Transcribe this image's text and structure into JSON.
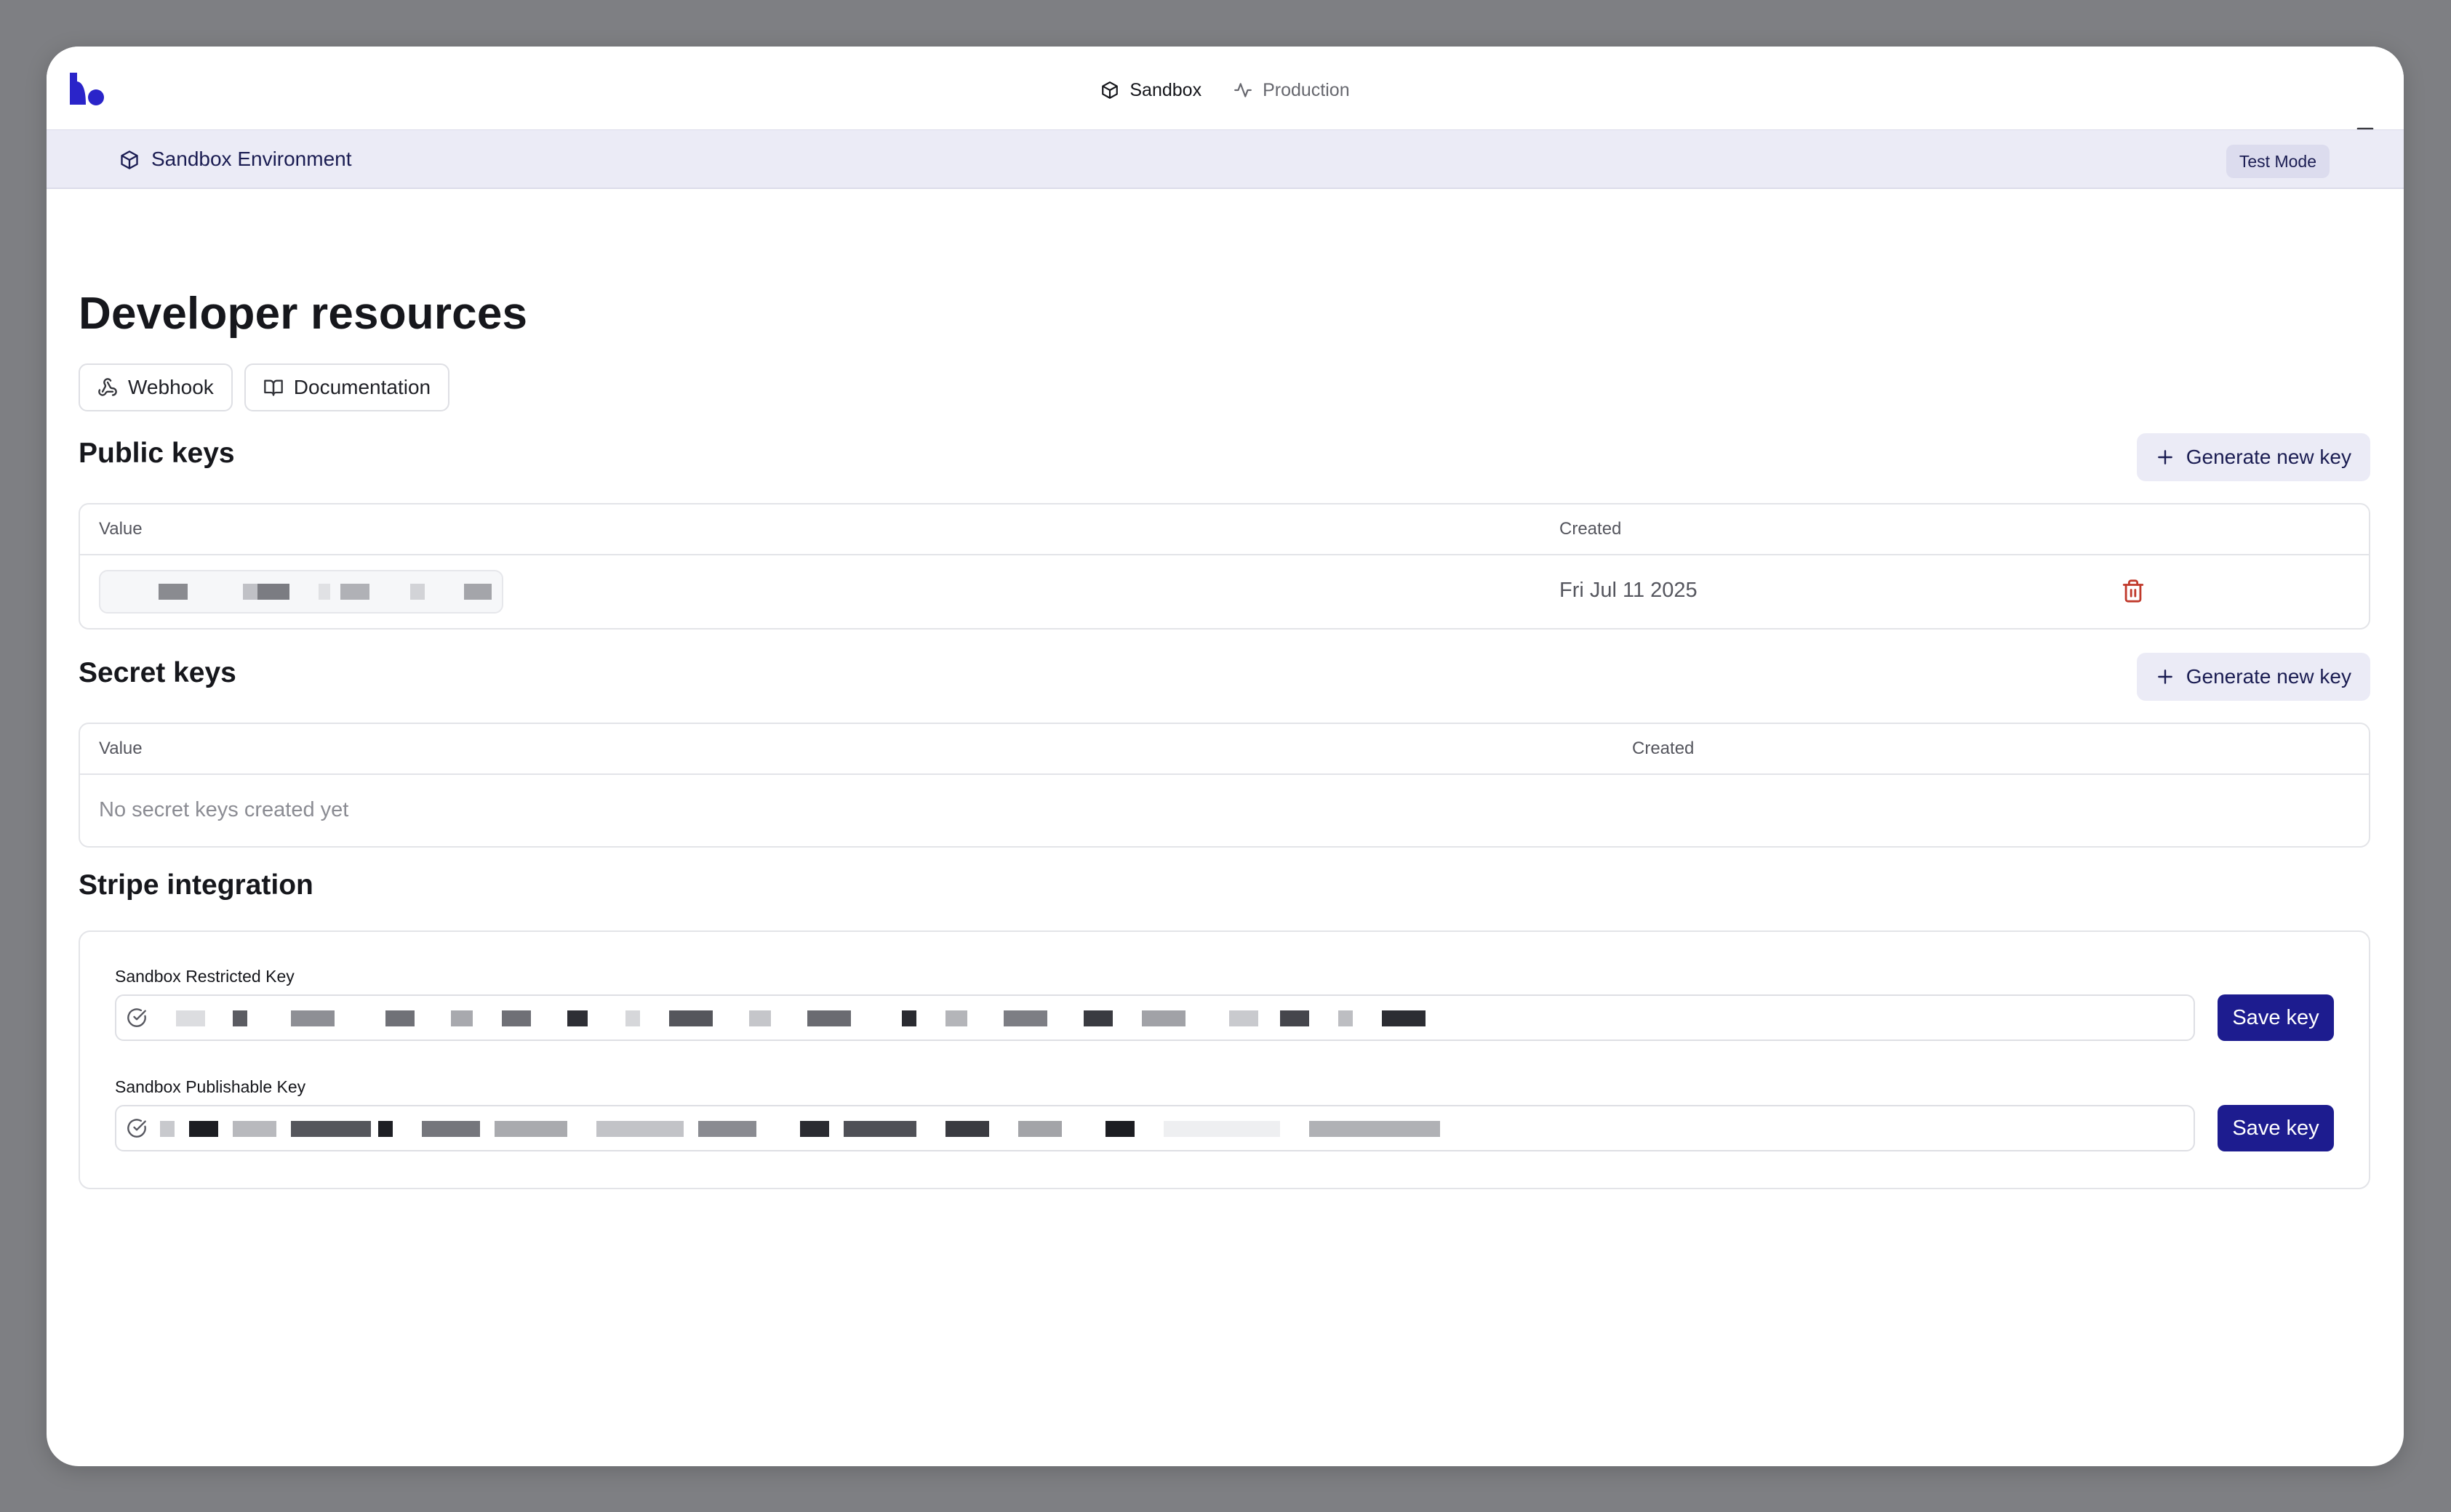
{
  "header": {
    "env_tabs": [
      {
        "label": "Sandbox",
        "icon": "box-icon",
        "active": true
      },
      {
        "label": "Production",
        "icon": "activity-icon",
        "active": false
      }
    ]
  },
  "banner": {
    "title": "Sandbox Environment",
    "badge": "Test Mode"
  },
  "page": {
    "title": "Developer resources",
    "links": [
      {
        "label": "Webhook",
        "icon": "webhook-icon"
      },
      {
        "label": "Documentation",
        "icon": "book-icon"
      }
    ]
  },
  "public_keys": {
    "title": "Public keys",
    "generate_label": "Generate new key",
    "columns": [
      "Value",
      "Created"
    ],
    "rows": [
      {
        "created": "Fri Jul 11 2025"
      }
    ]
  },
  "secret_keys": {
    "title": "Secret keys",
    "generate_label": "Generate new key",
    "columns": [
      "Value",
      "Created"
    ],
    "empty_text": "No secret keys created yet"
  },
  "stripe": {
    "title": "Stripe integration",
    "fields": [
      {
        "label": "Sandbox Restricted Key",
        "save_label": "Save key"
      },
      {
        "label": "Sandbox Publishable Key",
        "save_label": "Save key"
      }
    ]
  },
  "colors": {
    "brand": "#2a24c9",
    "primary_button": "#1d1c8f",
    "banner_bg": "#ebebf6",
    "danger": "#c0392b"
  }
}
